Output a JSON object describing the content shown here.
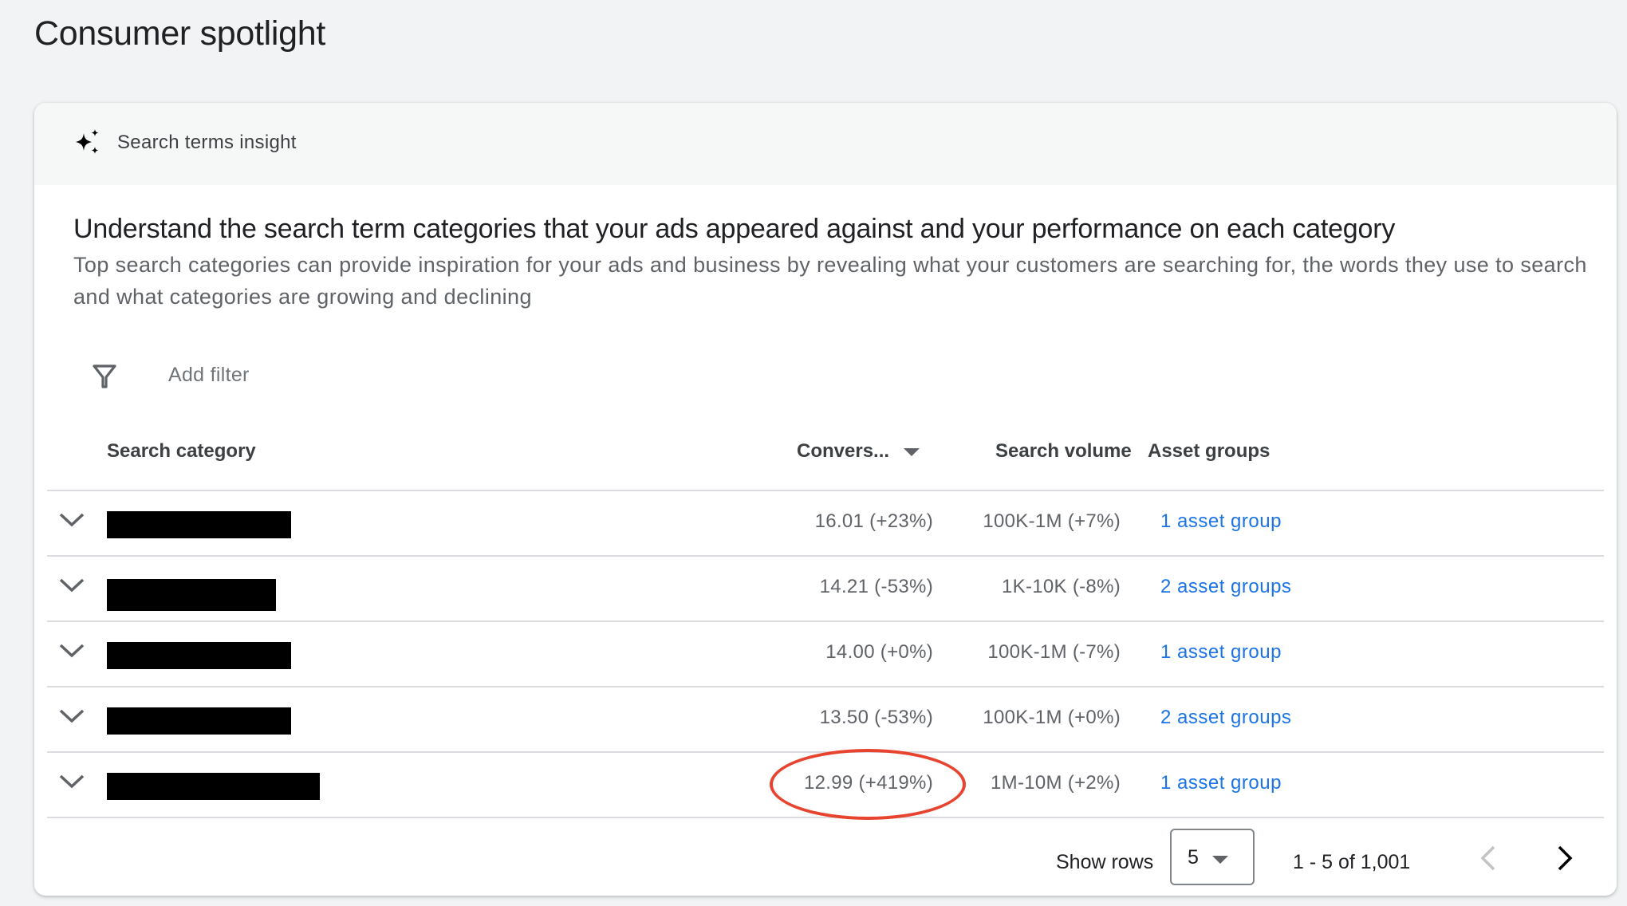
{
  "page": {
    "title": "Consumer spotlight"
  },
  "card": {
    "header_icon": "sparkle-icon",
    "header_label": "Search terms insight",
    "heading": "Understand the search term categories that your ads appeared against and your performance on each category",
    "description": "Top search categories can provide inspiration for your ads and business by revealing what your customers are searching for, the words they use to search and what categories are growing and declining"
  },
  "filter": {
    "icon": "filter-icon",
    "label": "Add filter"
  },
  "table": {
    "columns": {
      "category": "Search category",
      "conversions": "Convers...",
      "conversions_sort": "descending",
      "volume": "Search volume",
      "assets": "Asset groups"
    },
    "rows": [
      {
        "category": "[redacted]",
        "conversions": "16.01 (+23%)",
        "volume": "100K-1M (+7%)",
        "assets": "1 asset group"
      },
      {
        "category": "[redacted]",
        "conversions": "14.21 (-53%)",
        "volume": "1K-10K (-8%)",
        "assets": "2 asset groups"
      },
      {
        "category": "[redacted]",
        "conversions": "14.00 (+0%)",
        "volume": "100K-1M (-7%)",
        "assets": "1 asset group"
      },
      {
        "category": "[redacted]",
        "conversions": "13.50 (-53%)",
        "volume": "100K-1M (+0%)",
        "assets": "2 asset groups"
      },
      {
        "category": "[redacted]",
        "conversions": "12.99 (+419%)",
        "volume": "1M-10M (+2%)",
        "assets": "1 asset group",
        "highlighted": true
      }
    ]
  },
  "pagination": {
    "show_rows_label": "Show rows",
    "rows_per_page": "5",
    "range": "1 - 5 of 1,001",
    "prev_enabled": false,
    "next_enabled": true
  },
  "colors": {
    "link": "#1a73e8",
    "annotation": "#e8432e",
    "background": "#f1f3f4"
  }
}
